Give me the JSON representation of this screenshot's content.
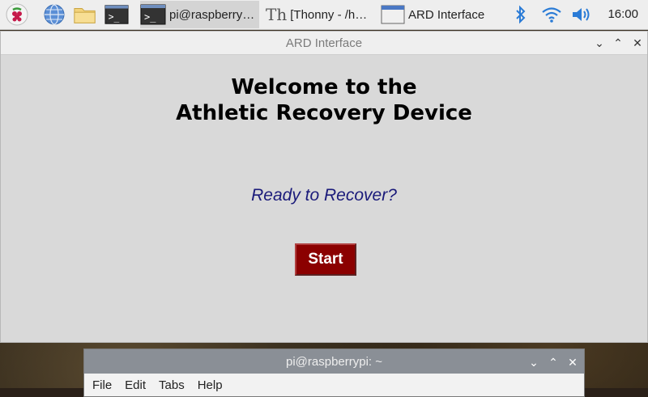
{
  "taskbar": {
    "tasks": [
      {
        "label": "pi@raspberry…"
      },
      {
        "label": "[Thonny  -  /h…"
      },
      {
        "label": "ARD Interface"
      }
    ],
    "clock": "16:00"
  },
  "window": {
    "title": "ARD Interface",
    "heading_line1": "Welcome to the",
    "heading_line2": "Athletic Recovery Device",
    "subtitle": "Ready to Recover?",
    "start_label": "Start",
    "colors": {
      "start_button": "#8b0000",
      "subtitle": "#1a1a7a"
    }
  },
  "terminal": {
    "title": "pi@raspberrypi: ~",
    "menu": [
      "File",
      "Edit",
      "Tabs",
      "Help"
    ]
  }
}
